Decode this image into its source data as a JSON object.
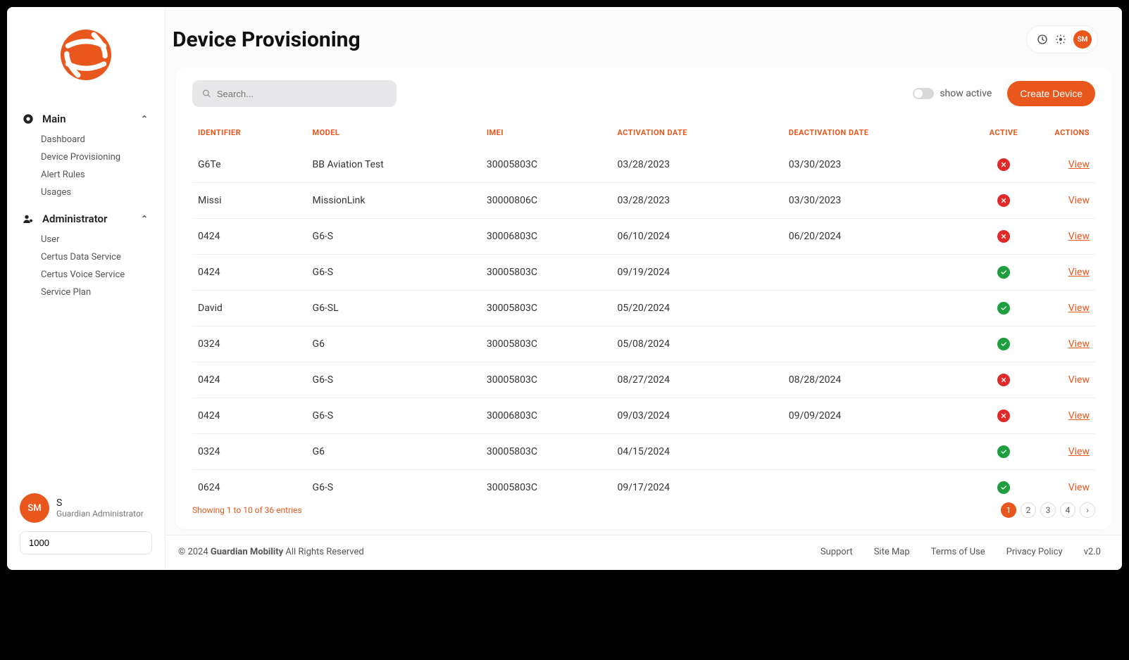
{
  "header": {
    "title": "Device Provisioning",
    "avatar": "SM"
  },
  "sidebar": {
    "groups": [
      {
        "label": "Main",
        "items": [
          "Dashboard",
          "Device Provisioning",
          "Alert Rules",
          "Usages"
        ]
      },
      {
        "label": "Administrator",
        "items": [
          "User",
          "Certus Data Service",
          "Certus Voice Service",
          "Service Plan"
        ]
      }
    ],
    "user": {
      "initials": "SM",
      "name": "S",
      "role": "Guardian Administrator"
    },
    "input_value": "1000"
  },
  "toolbar": {
    "search_placeholder": "Search...",
    "toggle_label": "show active",
    "create_label": "Create Device"
  },
  "table": {
    "columns": [
      "IDENTIFIER",
      "MODEL",
      "IMEI",
      "ACTIVATION DATE",
      "DEACTIVATION DATE",
      "ACTIVE",
      "ACTIONS"
    ],
    "rows": [
      {
        "identifier": "G6Te",
        "model": "BB Aviation Test",
        "imei": "30005803C",
        "activation": "03/28/2023",
        "deactivation": "03/30/2023",
        "active": false,
        "view_underline": true
      },
      {
        "identifier": "Missi",
        "model": "MissionLink",
        "imei": "30000806C",
        "activation": "03/28/2023",
        "deactivation": "03/30/2023",
        "active": false,
        "view_underline": false
      },
      {
        "identifier": "0424",
        "model": "G6-S",
        "imei": "30006803C",
        "activation": "06/10/2024",
        "deactivation": "06/20/2024",
        "active": false,
        "view_underline": true
      },
      {
        "identifier": "0424",
        "model": "G6-S",
        "imei": "30005803C",
        "activation": "09/19/2024",
        "deactivation": "",
        "active": true,
        "view_underline": true
      },
      {
        "identifier": "David",
        "model": "G6-SL",
        "imei": "30005803C",
        "activation": "05/20/2024",
        "deactivation": "",
        "active": true,
        "view_underline": true
      },
      {
        "identifier": "0324",
        "model": "G6",
        "imei": "30005803C",
        "activation": "05/08/2024",
        "deactivation": "",
        "active": true,
        "view_underline": true
      },
      {
        "identifier": "0424",
        "model": "G6-S",
        "imei": "30005803C",
        "activation": "08/27/2024",
        "deactivation": "08/28/2024",
        "active": false,
        "view_underline": false
      },
      {
        "identifier": "0424",
        "model": "G6-S",
        "imei": "30006803C",
        "activation": "09/03/2024",
        "deactivation": "09/09/2024",
        "active": false,
        "view_underline": true
      },
      {
        "identifier": "0324",
        "model": "G6",
        "imei": "30005803C",
        "activation": "04/15/2024",
        "deactivation": "",
        "active": true,
        "view_underline": true
      },
      {
        "identifier": "0624",
        "model": "G6-S",
        "imei": "30005803C",
        "activation": "09/17/2024",
        "deactivation": "",
        "active": true,
        "view_underline": false
      }
    ],
    "view_label": "View"
  },
  "pagination": {
    "showing": "Showing 1 to 10 of 36 entries",
    "pages": [
      "1",
      "2",
      "3",
      "4"
    ],
    "active_index": 0,
    "next": "›"
  },
  "footer": {
    "copyright_prefix": "© 2024 ",
    "company": "Guardian Mobility",
    "copyright_suffix": " All Rights Reserved",
    "links": [
      "Support",
      "Site Map",
      "Terms of Use",
      "Privacy Policy",
      "v2.0"
    ]
  }
}
